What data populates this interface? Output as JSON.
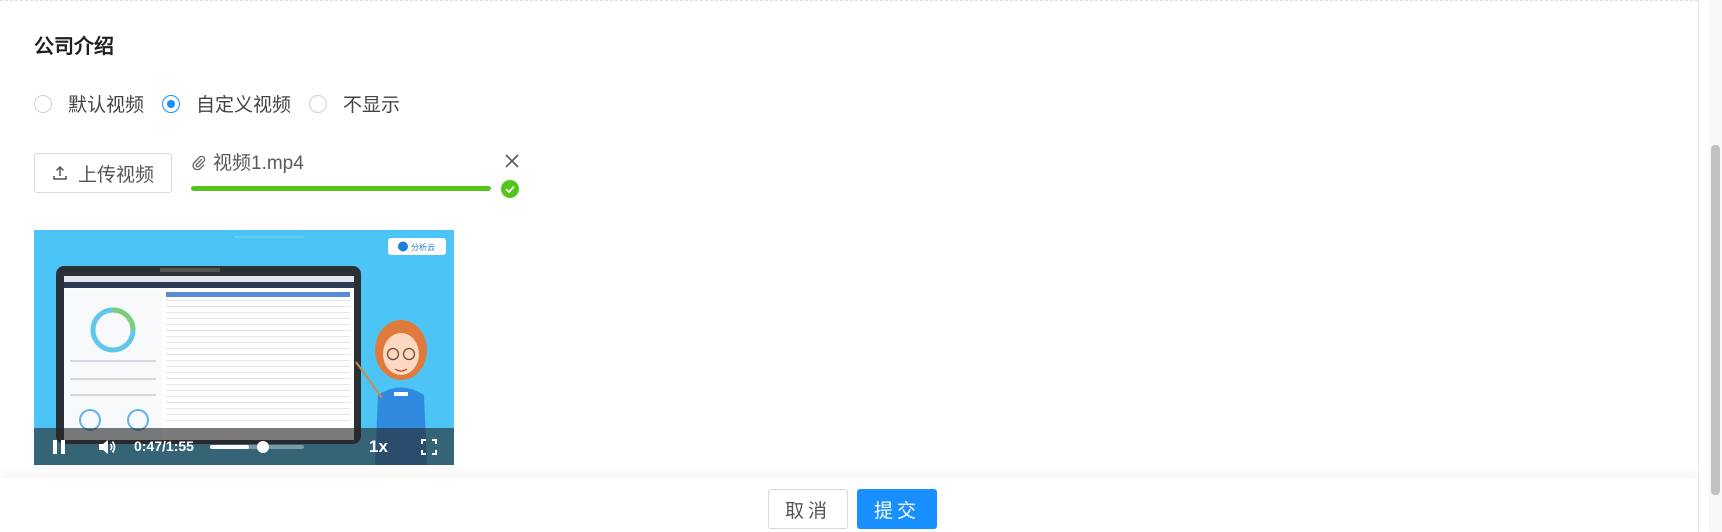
{
  "section": {
    "title": "公司介绍"
  },
  "video_options": {
    "items": [
      {
        "label": "默认视频",
        "checked": false
      },
      {
        "label": "自定义视频",
        "checked": true
      },
      {
        "label": "不显示",
        "checked": false
      }
    ]
  },
  "upload": {
    "button_label": "上传视频",
    "button_icon": "upload-icon",
    "file": {
      "name": "视频1.mp4",
      "progress_fraction": 1.0,
      "status": "success"
    }
  },
  "player": {
    "brand_tag": "分析云",
    "current_time": "0:47",
    "duration": "1:55",
    "time_display": "0:47/1:55",
    "played_fraction": 0.41,
    "speed": "1x",
    "icons": [
      "pause-icon",
      "volume-icon",
      "fullscreen-icon"
    ]
  },
  "footer": {
    "cancel_label": "取消",
    "submit_label": "提交"
  },
  "colors": {
    "primary": "#1890ff",
    "success": "#52c41a",
    "video_bg": "#4cc4f6"
  }
}
